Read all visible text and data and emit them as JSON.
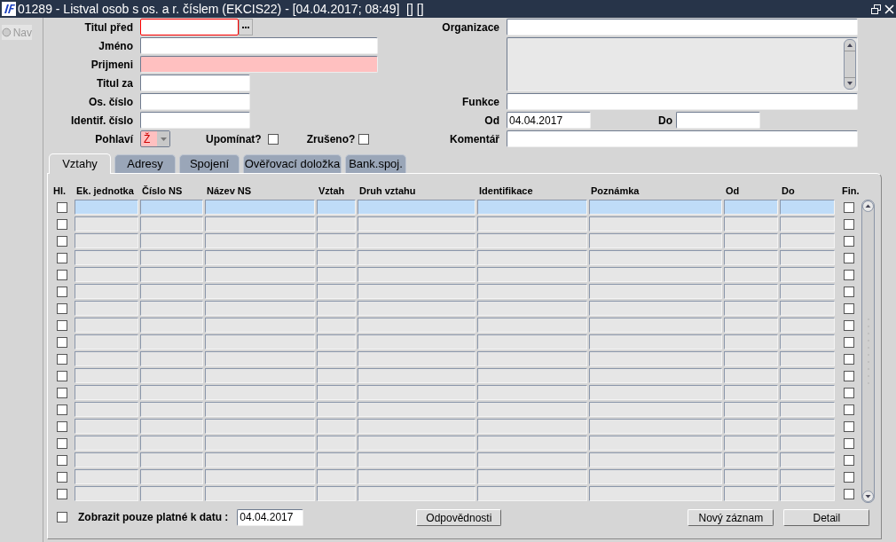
{
  "window": {
    "title": "01289 - Listval osob s os. a r. číslem (EKCIS22) - [04.04.2017; 08:49]  [] []"
  },
  "nav": {
    "label": "Nav",
    "selected": false,
    "disabled": true
  },
  "left_fields": [
    {
      "kind": "lookup",
      "label": "Titul před",
      "focused": true,
      "required": false
    },
    {
      "kind": "wide",
      "label": "Jméno",
      "focused": false,
      "required": false
    },
    {
      "kind": "wide",
      "label": "Prijmeni",
      "focused": false,
      "required": true
    },
    {
      "kind": "text",
      "label": "Titul za",
      "focused": false,
      "required": false
    },
    {
      "kind": "text",
      "label": "Os. číslo",
      "focused": false,
      "required": false
    },
    {
      "kind": "text",
      "label": "Identif. číslo",
      "focused": false,
      "required": false
    },
    {
      "kind": "select",
      "label": "Pohlaví",
      "value": "Ž",
      "focused": false,
      "required": true
    }
  ],
  "checkboxes": [
    {
      "label": "Upomínat?",
      "checked": false
    },
    {
      "label": "Zrušeno?",
      "checked": false
    }
  ],
  "right_fields": [
    {
      "kind": "text",
      "label": "Organizace"
    },
    {
      "kind": "textarea"
    },
    {
      "kind": "text",
      "label": "Funkce"
    },
    {
      "kind": "range",
      "label": "Od",
      "value": "04.04.2017",
      "label_2": "Do"
    },
    {
      "kind": "text",
      "label": "Komentář"
    }
  ],
  "tabs": [
    {
      "label": "Vztahy",
      "selected": true
    },
    {
      "label": "Adresy",
      "selected": false
    },
    {
      "label": "Spojení",
      "selected": false
    },
    {
      "label": "Ověřovací doložka",
      "selected": false
    },
    {
      "label": "Bank.spoj.",
      "selected": false
    }
  ],
  "table": {
    "columns": [
      "Hl.",
      "Ek. jednotka",
      "Číslo NS",
      "Název NS",
      "Vztah",
      "Druh vztahu",
      "Identifikace",
      "Poznámka",
      "Od",
      "Do",
      "Fin."
    ],
    "rows": [
      {
        "selected": true,
        "hl": false,
        "fin": false
      },
      {
        "selected": false,
        "hl": false,
        "fin": false
      },
      {
        "selected": false,
        "hl": false,
        "fin": false
      },
      {
        "selected": false,
        "hl": false,
        "fin": false
      },
      {
        "selected": false,
        "hl": false,
        "fin": false
      },
      {
        "selected": false,
        "hl": false,
        "fin": false
      },
      {
        "selected": false,
        "hl": false,
        "fin": false
      },
      {
        "selected": false,
        "hl": false,
        "fin": false
      },
      {
        "selected": false,
        "hl": false,
        "fin": false
      },
      {
        "selected": false,
        "hl": false,
        "fin": false
      },
      {
        "selected": false,
        "hl": false,
        "fin": false
      },
      {
        "selected": false,
        "hl": false,
        "fin": false
      },
      {
        "selected": false,
        "hl": false,
        "fin": false
      },
      {
        "selected": false,
        "hl": false,
        "fin": false
      },
      {
        "selected": false,
        "hl": false,
        "fin": false
      },
      {
        "selected": false,
        "hl": false,
        "fin": false
      },
      {
        "selected": false,
        "hl": false,
        "fin": false
      },
      {
        "selected": false,
        "hl": false,
        "fin": false
      }
    ]
  },
  "footer": {
    "filter_label": "Zobrazit pouze platné k datu :",
    "filter_checked": false,
    "date": "04.04.2017",
    "buttons": [
      "Odpovědnosti",
      "Nový záznam",
      "Detail"
    ]
  }
}
